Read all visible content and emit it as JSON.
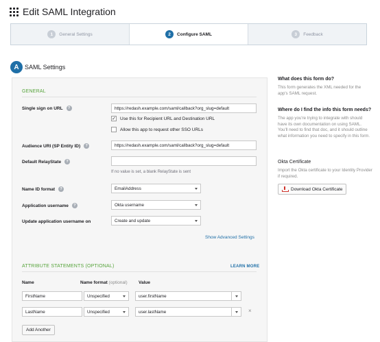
{
  "page": {
    "title": "Edit SAML Integration"
  },
  "wizard": {
    "steps": [
      {
        "num": "1",
        "label": "General Settings"
      },
      {
        "num": "2",
        "label": "Configure SAML"
      },
      {
        "num": "3",
        "label": "Feedback"
      }
    ],
    "active_step": 2
  },
  "section": {
    "badge": "A",
    "title": "SAML Settings"
  },
  "general": {
    "heading": "GENERAL",
    "sso_url": {
      "label": "Single sign on URL",
      "value": "https://redash.example.com/saml/callback?org_slug=default"
    },
    "recipient_checkbox": {
      "label": "Use this for Recipient URL and Destination URL",
      "checked": true,
      "mark": "✓"
    },
    "other_sso_checkbox": {
      "label": "Allow this app to request other SSO URLs",
      "checked": false
    },
    "audience_uri": {
      "label": "Audience URI (SP Entity ID)",
      "value": "https://redash.example.com/saml/callback?org_slug=default"
    },
    "relay_state": {
      "label": "Default RelayState",
      "value": "",
      "hint": "If no value is set, a blank RelayState is sent"
    },
    "name_id_format": {
      "label": "Name ID format",
      "value": "EmailAddress"
    },
    "app_username": {
      "label": "Application username",
      "value": "Okta username"
    },
    "update_username": {
      "label": "Update application username on",
      "value": "Create and update"
    },
    "advanced_link": "Show Advanced Settings"
  },
  "attributes": {
    "heading": "ATTRIBUTE STATEMENTS (OPTIONAL)",
    "learn_more": "LEARN MORE",
    "columns": {
      "name": "Name",
      "format": "Name format",
      "format_opt": "(optional)",
      "value": "Value"
    },
    "rows": [
      {
        "name": "FirstName",
        "format": "Unspecified",
        "value": "user.firstName"
      },
      {
        "name": "LastName",
        "format": "Unspecified",
        "value": "user.lastName",
        "remove": "×"
      }
    ],
    "add_button": "Add Another"
  },
  "sidebar": {
    "q1": "What does this form do?",
    "a1": "This form generates the XML needed for the app's SAML request.",
    "q2": "Where do I find the info this form needs?",
    "a2": "The app you're trying to integrate with should have its own documentation on using SAML. You'll need to find that doc, and it should outline what information you need to specify in this form.",
    "cert_title": "Okta Certificate",
    "cert_text": "Import the Okta certificate to your Identity Provider if required.",
    "download_button": "Download Okta Certificate"
  },
  "icons": {
    "app": "grid-icon",
    "help": "question-circle-icon",
    "download": "download-icon",
    "dropdown": "caret-down-icon"
  },
  "colors": {
    "accent": "#1f6fa7",
    "group_label": "#55a33a",
    "download_icon": "#d0342c"
  }
}
